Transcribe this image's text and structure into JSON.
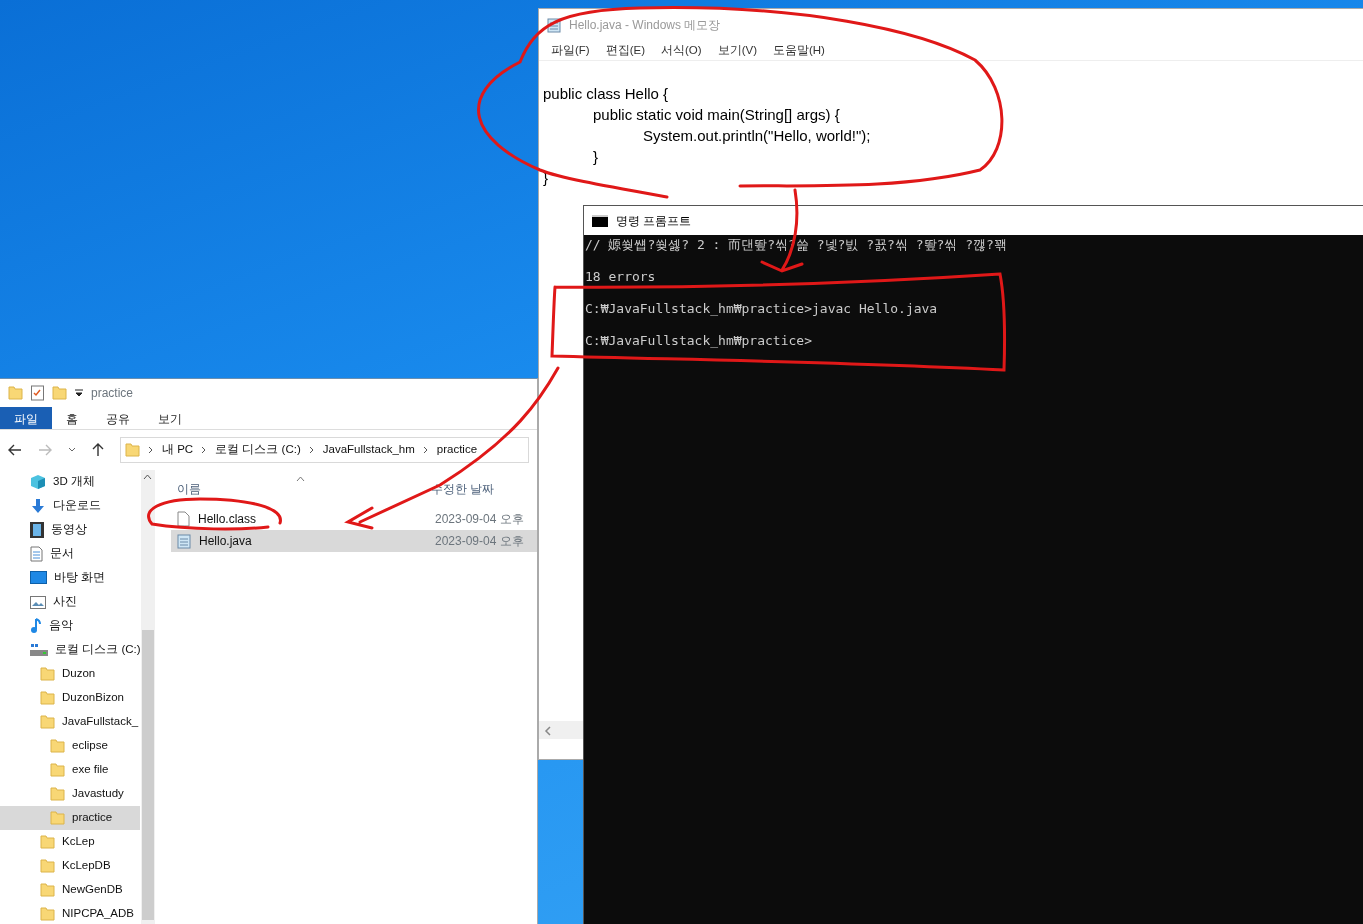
{
  "notepad": {
    "title": "Hello.java - Windows 메모장",
    "menu": [
      "파일(F)",
      "편집(E)",
      "서식(O)",
      "보기(V)",
      "도움말(H)"
    ],
    "lines": [
      "public class Hello {",
      "            public static void main(String[] args) {",
      "                        System.out.println(\"Hello, world!\");",
      "            }",
      "}"
    ]
  },
  "cmd": {
    "title": "명령 프롬프트",
    "lines": [
      "// 嫄쒖썝?쒖셿? 2 : 而댄뙆?씪?쓽 ?넻?빐 ?꾨?씪 ?뙆?씪 ?깮?꽦",
      "18 errors",
      "C:₩JavaFullstack_hm₩practice>javac Hello.java",
      "C:₩JavaFullstack_hm₩practice>"
    ]
  },
  "explorer": {
    "title": "practice",
    "ribbon_tabs": [
      {
        "label": "파일",
        "selected": true
      },
      {
        "label": "홈",
        "selected": false
      },
      {
        "label": "공유",
        "selected": false
      },
      {
        "label": "보기",
        "selected": false
      }
    ],
    "breadcrumb": [
      "내 PC",
      "로컬 디스크 (C:)",
      "JavaFullstack_hm",
      "practice"
    ],
    "nav_tree": [
      {
        "label": "3D 개체",
        "kind": "cube",
        "selected": false
      },
      {
        "label": "다운로드",
        "kind": "download",
        "selected": false
      },
      {
        "label": "동영상",
        "kind": "video",
        "selected": false
      },
      {
        "label": "문서",
        "kind": "document",
        "selected": false
      },
      {
        "label": "바탕 화면",
        "kind": "desktop",
        "selected": false
      },
      {
        "label": "사진",
        "kind": "photo",
        "selected": false
      },
      {
        "label": "음악",
        "kind": "music",
        "selected": false
      },
      {
        "label": "로컬 디스크 (C:)",
        "kind": "drive",
        "selected": false,
        "children": [
          {
            "label": "Duzon",
            "kind": "folder",
            "selected": false
          },
          {
            "label": "DuzonBizon",
            "kind": "folder",
            "selected": false
          },
          {
            "label": "JavaFullstack_",
            "kind": "folder",
            "selected": false,
            "children": [
              {
                "label": "eclipse",
                "kind": "folder",
                "selected": false
              },
              {
                "label": "exe file",
                "kind": "folder",
                "selected": false
              },
              {
                "label": "Javastudy",
                "kind": "folder",
                "selected": false
              },
              {
                "label": "practice",
                "kind": "folder",
                "selected": true
              }
            ]
          },
          {
            "label": "KcLep",
            "kind": "folder",
            "selected": false
          },
          {
            "label": "KcLepDB",
            "kind": "folder",
            "selected": false
          },
          {
            "label": "NewGenDB",
            "kind": "folder",
            "selected": false
          },
          {
            "label": "NIPCPA_ADB",
            "kind": "folder",
            "selected": false
          }
        ]
      }
    ],
    "columns": [
      "이름",
      "수정한 날짜"
    ],
    "files": [
      {
        "name": "Hello.class",
        "kind": "file",
        "modified": "2023-09-04 오후",
        "selected": false
      },
      {
        "name": "Hello.java",
        "kind": "text",
        "modified": "2023-09-04 오후",
        "selected": true
      }
    ]
  }
}
